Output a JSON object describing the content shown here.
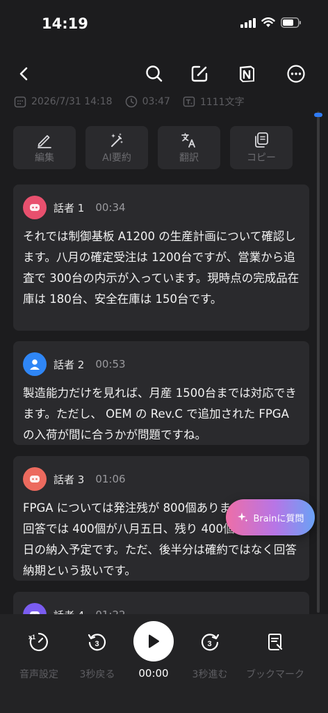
{
  "status": {
    "time": "14:19"
  },
  "meta": {
    "date": "2026/7/31  14:18",
    "duration": "03:47",
    "chars": "1111文字"
  },
  "actions": [
    {
      "label": "編集",
      "icon": "pencil-icon"
    },
    {
      "label": "AI要約",
      "icon": "magic-wand-icon"
    },
    {
      "label": "翻訳",
      "icon": "translate-icon"
    },
    {
      "label": "コピー",
      "icon": "copy-icon"
    }
  ],
  "transcript": [
    {
      "speaker": "話者 1",
      "time": "00:34",
      "color": "#e8506e",
      "text": "それでは制御基板 A1200 の生産計画について確認します。八月の確定受注は 1200台ですが、営業から追査で 300台の内示が入っています。現時点の完成品在庫は 180台、安全在庫は 150台です。"
    },
    {
      "speaker": "話者 2",
      "time": "00:53",
      "color": "#2f86f6",
      "text": "製造能力だけを見れば、月産 1500台までは対応できます。ただし、 OEM の Rev.C で追加された FPGA の入荷が間に合うかが問題ですね。"
    },
    {
      "speaker": "話者 3",
      "time": "01:06",
      "color": "#ec6a5e",
      "text": "FPGA については発注残が 800個あります。メーカー回答では 400個が八月五日、残り 400個が八月十九日の納入予定です。ただ、後半分は確約ではなく回答納期という扱いです。"
    },
    {
      "speaker": "話者 4",
      "time": "01:22",
      "color": "#7a5cf0",
      "text": ""
    }
  ],
  "brain": {
    "label": "Brainに質問"
  },
  "player": {
    "speed_label": "音声設定",
    "back_label": "3秒戻る",
    "time": "00:00",
    "forward_label": "3秒進む",
    "bookmark_label": "ブックマーク",
    "speed_badge": "x1",
    "skip_num": "3"
  },
  "colors": {
    "accent": "#2f7bf5",
    "background": "#1c1c1e",
    "card": "#2a2a2d"
  }
}
